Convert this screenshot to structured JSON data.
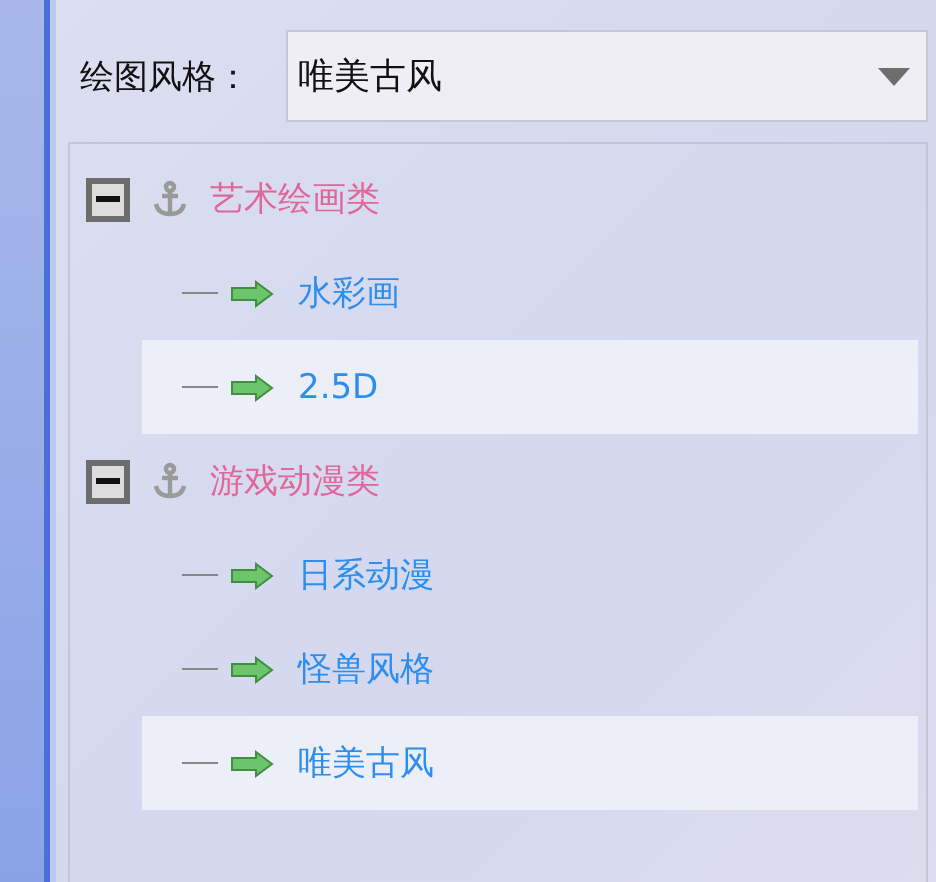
{
  "style_field": {
    "label": "绘图风格：",
    "value": "唯美古风"
  },
  "tree": [
    {
      "label": "艺术绘画类",
      "expanded": true,
      "children": [
        {
          "label": "水彩画",
          "selected": false
        },
        {
          "label": "2.5D",
          "selected": true
        }
      ]
    },
    {
      "label": "游戏动漫类",
      "expanded": true,
      "children": [
        {
          "label": "日系动漫",
          "selected": false
        },
        {
          "label": "怪兽风格",
          "selected": false
        },
        {
          "label": "唯美古风",
          "selected": true
        }
      ]
    }
  ]
}
